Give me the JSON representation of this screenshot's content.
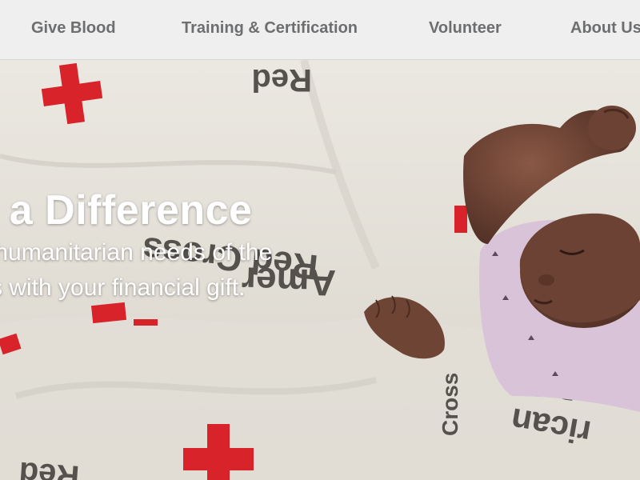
{
  "nav": {
    "items": [
      {
        "label": "Give Blood"
      },
      {
        "label": "Training & Certification"
      },
      {
        "label": "Volunteer"
      },
      {
        "label": "About Us"
      }
    ]
  },
  "hero": {
    "headline": "ke a Difference",
    "subtext_line1": "nt humanitarian needs of the",
    "subtext_line2": "s with your financial gift.",
    "blanket_print": [
      "Red Cross",
      "American",
      "Red",
      "Cross",
      "rican"
    ],
    "colors": {
      "blanket": "#e9e6df",
      "red_cross": "#d8232a",
      "print_text": "#55524e",
      "skin": "#6b4234",
      "onesie": "#d9c3d9",
      "nav_bg": "#efefef",
      "nav_text": "#6d6e70"
    }
  }
}
